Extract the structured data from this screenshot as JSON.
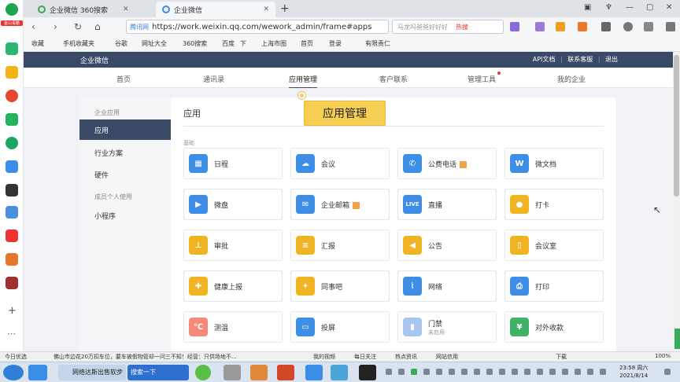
{
  "browser": {
    "tabs": [
      {
        "label": "企业微信 360搜索"
      },
      {
        "label": "企业微信"
      }
    ],
    "address": {
      "site_label": "腾讯网",
      "url": "https://work.weixin.qq.com/wework_admin/frame#apps"
    },
    "search": {
      "placeholder": "马龙吗爸爸好好好",
      "hot_label": "热搜"
    },
    "bookmarks": [
      "收藏",
      "手机收藏夹",
      "谷歌",
      "网址大全",
      "360搜索",
      "百度",
      "下",
      "上海市图",
      "首页",
      "登录",
      "有限责仁"
    ]
  },
  "left_rail": {
    "top_badge": "金山毒霸"
  },
  "wework": {
    "logo": "企业微信",
    "header_links": [
      "API文档",
      "联系客服",
      "退出"
    ],
    "nav": [
      "首页",
      "通讯录",
      "应用管理",
      "客户联系",
      "管理工具",
      "我的企业"
    ],
    "active_nav": "应用管理",
    "sidebar": {
      "heading1": "企业应用",
      "active": "应用",
      "items": [
        "行业方案",
        "硬件"
      ],
      "heading2": "成员个人使用",
      "items2": [
        "小程序"
      ]
    },
    "page_title": "应用",
    "tooltip": "应用管理",
    "section_label": "基础",
    "apps": [
      {
        "label": "日程",
        "icon": "calendar-icon",
        "color": "#3e8ee8"
      },
      {
        "label": "会议",
        "icon": "cloud-icon",
        "color": "#3e8ee8"
      },
      {
        "label": "公费电话",
        "icon": "phone-icon",
        "color": "#3e8ee8",
        "badge": true
      },
      {
        "label": "微文档",
        "icon": "document-w-icon",
        "color": "#3e8ee8"
      },
      {
        "label": "微盘",
        "icon": "disk-icon",
        "color": "#3e8ee8"
      },
      {
        "label": "企业邮箱",
        "icon": "mail-icon",
        "color": "#3e8ee8",
        "badge": true
      },
      {
        "label": "直播",
        "icon": "live-icon",
        "color": "#3e8ee8"
      },
      {
        "label": "打卡",
        "icon": "location-icon",
        "color": "#f0b323"
      },
      {
        "label": "审批",
        "icon": "stamp-icon",
        "color": "#f0b323"
      },
      {
        "label": "汇报",
        "icon": "report-icon",
        "color": "#f0b323"
      },
      {
        "label": "公告",
        "icon": "megaphone-icon",
        "color": "#f0b323"
      },
      {
        "label": "会议室",
        "icon": "door-icon",
        "color": "#f0b323"
      },
      {
        "label": "健康上报",
        "icon": "health-icon",
        "color": "#f0b323"
      },
      {
        "label": "同事吧",
        "icon": "community-icon",
        "color": "#f0b323"
      },
      {
        "label": "网络",
        "icon": "network-icon",
        "color": "#3e8ee8"
      },
      {
        "label": "打印",
        "icon": "printer-icon",
        "color": "#3e8ee8"
      },
      {
        "label": "测温",
        "icon": "thermometer-icon",
        "color": "#f58a7a"
      },
      {
        "label": "投屏",
        "icon": "screen-icon",
        "color": "#3e8ee8"
      },
      {
        "label": "门禁",
        "icon": "access-icon",
        "color": "#a9c6f0",
        "sub": "未启用"
      },
      {
        "label": "对外收款",
        "icon": "yuan-icon",
        "color": "#3fb268"
      }
    ]
  },
  "statusbar": {
    "items": [
      "今日优选",
      "佛山市边花20万扣车位，要车被假物管却一问三不知！经营：只供场地不…",
      "我的视频",
      "每日关注",
      "热点资讯",
      "网站信用",
      "下载",
      "100%"
    ]
  },
  "taskbar": {
    "items": [
      "网络达斯出售软步",
      "搜索一下"
    ],
    "time": "23:58 周六",
    "date": "2021/8/14"
  }
}
